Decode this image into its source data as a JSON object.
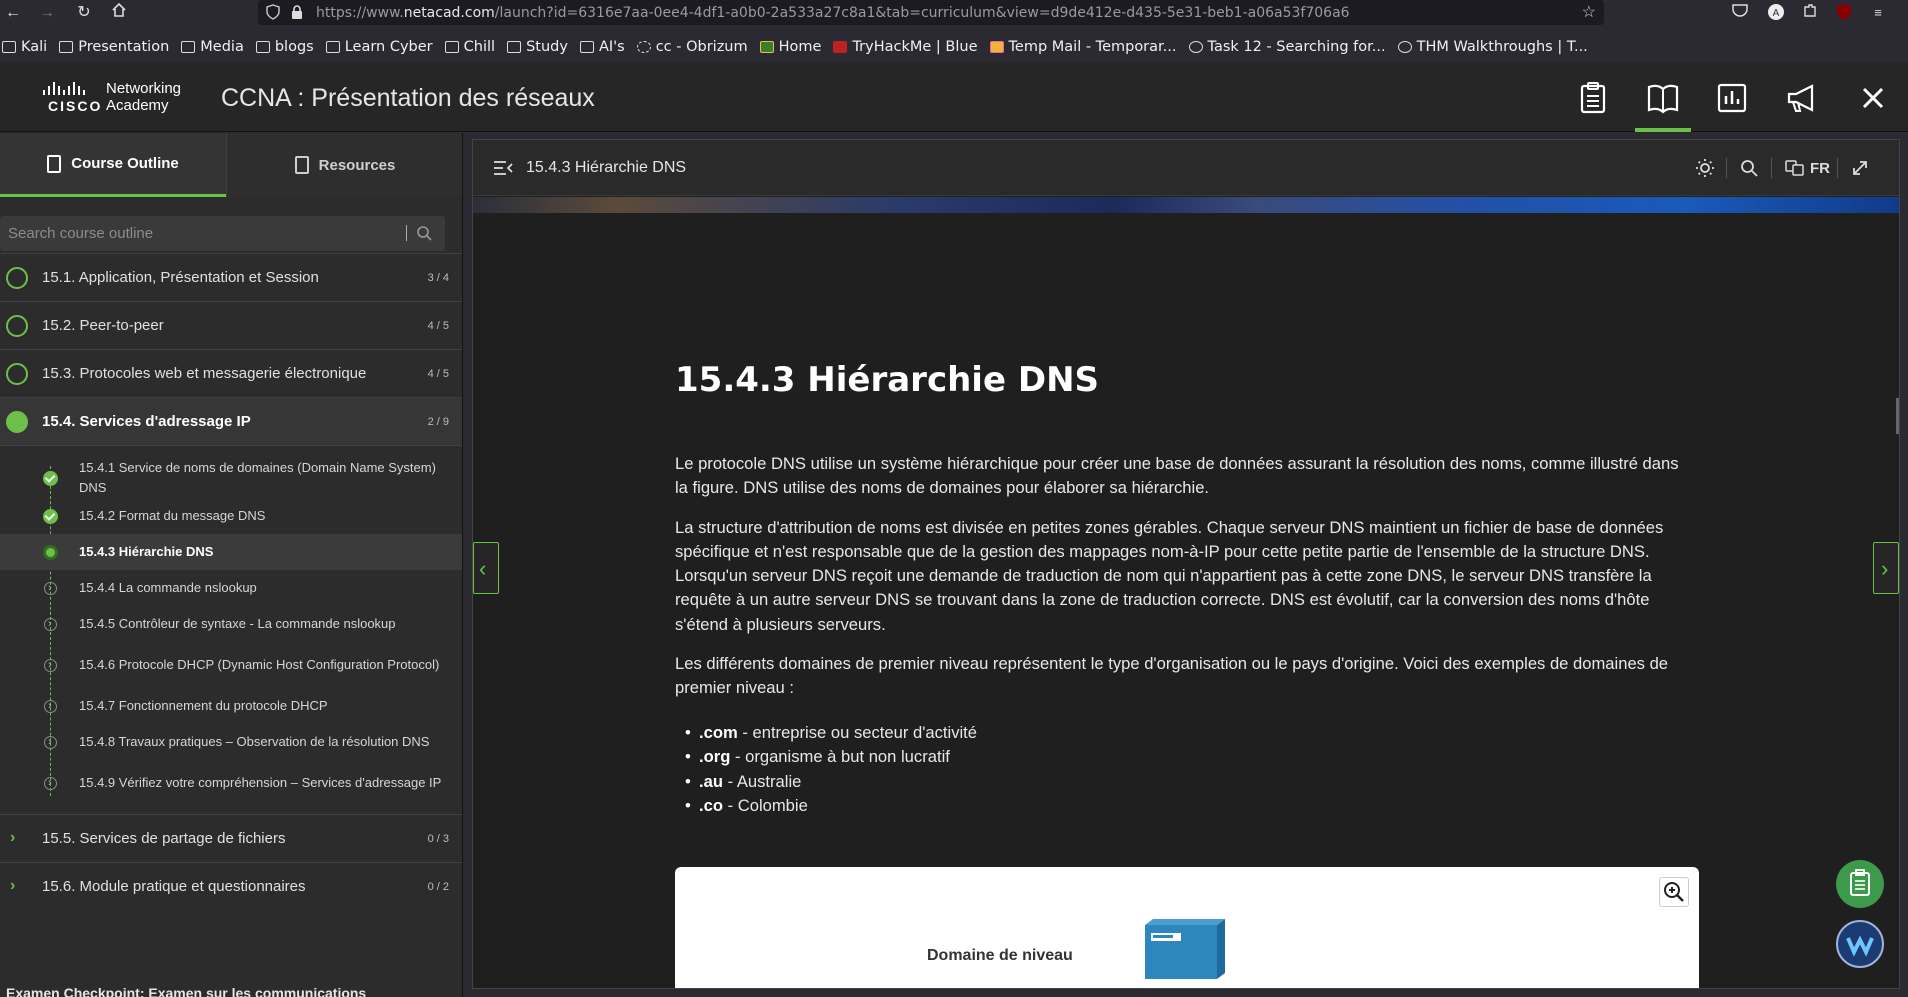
{
  "browser": {
    "url_prefix": "https://www.",
    "url_domain": "netacad.com",
    "url_rest": "/launch?id=6316e7aa-0ee4-4df1-a0b0-2a533a27c8a1&tab=curriculum&view=d9de412e-d435-5e31-beb1-a06a53f706a6",
    "bookmarks": [
      "Kali",
      "Presentation",
      "Media",
      "blogs",
      "Learn Cyber",
      "Chill",
      "Study",
      "AI's",
      "cc - Obrizum",
      "Home",
      "TryHackMe | Blue",
      "Temp Mail - Temporar...",
      "Task 12 - Searching for...",
      "THM Walkthroughs | T..."
    ]
  },
  "header": {
    "brand_line1": "Networking",
    "brand_line2": "Academy",
    "brand_word": "CISCO",
    "course_title": "CCNA : Présentation des réseaux"
  },
  "sidebar": {
    "tab_outline": "Course Outline",
    "tab_resources": "Resources",
    "search_placeholder": "Search course outline",
    "sections": [
      {
        "label": "15.1. Application, Présentation et Session",
        "count": "3 / 4"
      },
      {
        "label": "15.2. Peer-to-peer",
        "count": "4 / 5"
      },
      {
        "label": "15.3. Protocoles web et messagerie électronique",
        "count": "4 / 5"
      },
      {
        "label": "15.4. Services d'adressage IP",
        "count": "2 / 9"
      },
      {
        "label": "15.5. Services de partage de fichiers",
        "count": "0 / 3"
      },
      {
        "label": "15.6. Module pratique et questionnaires",
        "count": "0 / 2"
      }
    ],
    "subs": [
      "15.4.1 Service de noms de domaines (Domain Name System) DNS",
      "15.4.2 Format du message DNS",
      "15.4.3 Hiérarchie DNS",
      "15.4.4 La commande nslookup",
      "15.4.5 Contrôleur de syntaxe - La commande nslookup",
      "15.4.6 Protocole DHCP (Dynamic Host Configuration Protocol)",
      "15.4.7 Fonctionnement du protocole DHCP",
      "15.4.8 Travaux pratiques – Observation de la résolution DNS",
      "15.4.9 Vérifiez votre compréhension – Services d'adressage IP"
    ],
    "checkpoint": "Examen Checkpoint: Examen sur les communications"
  },
  "content": {
    "breadcrumb": "15.4.3 Hiérarchie DNS",
    "lang": "FR",
    "title": "15.4.3 Hiérarchie DNS",
    "p1": "Le protocole DNS utilise un système hiérarchique pour créer une base de données assurant la résolution des noms, comme illustré dans la figure. DNS utilise des noms de domaines pour élaborer sa hiérarchie.",
    "p2": "La structure d'attribution de noms est divisée en petites zones gérables. Chaque serveur DNS maintient un fichier de base de données spécifique et n'est responsable que de la gestion des mappages nom-à-IP pour cette petite partie de l'ensemble de la structure DNS. Lorsqu'un serveur DNS reçoit une demande de traduction de nom qui n'appartient pas à cette zone DNS, le serveur DNS transfère la requête à un autre serveur DNS se trouvant dans la zone de traduction correcte. DNS est évolutif, car la conversion des noms d'hôte s'étend à plusieurs serveurs.",
    "p3": "Les différents domaines de premier niveau représentent le type d'organisation ou le pays d'origine. Voici des exemples de domaines de premier niveau :",
    "list": [
      {
        "key": ".com",
        "desc": " - entreprise ou secteur d'activité"
      },
      {
        "key": ".org",
        "desc": " - organisme à but non lucratif"
      },
      {
        "key": ".au",
        "desc": " - Australie"
      },
      {
        "key": ".co",
        "desc": " - Colombie"
      }
    ],
    "figure_label": "Domaine de niveau"
  },
  "colors": {
    "accent": "#6cc04a",
    "bg": "#1f1f1f"
  }
}
